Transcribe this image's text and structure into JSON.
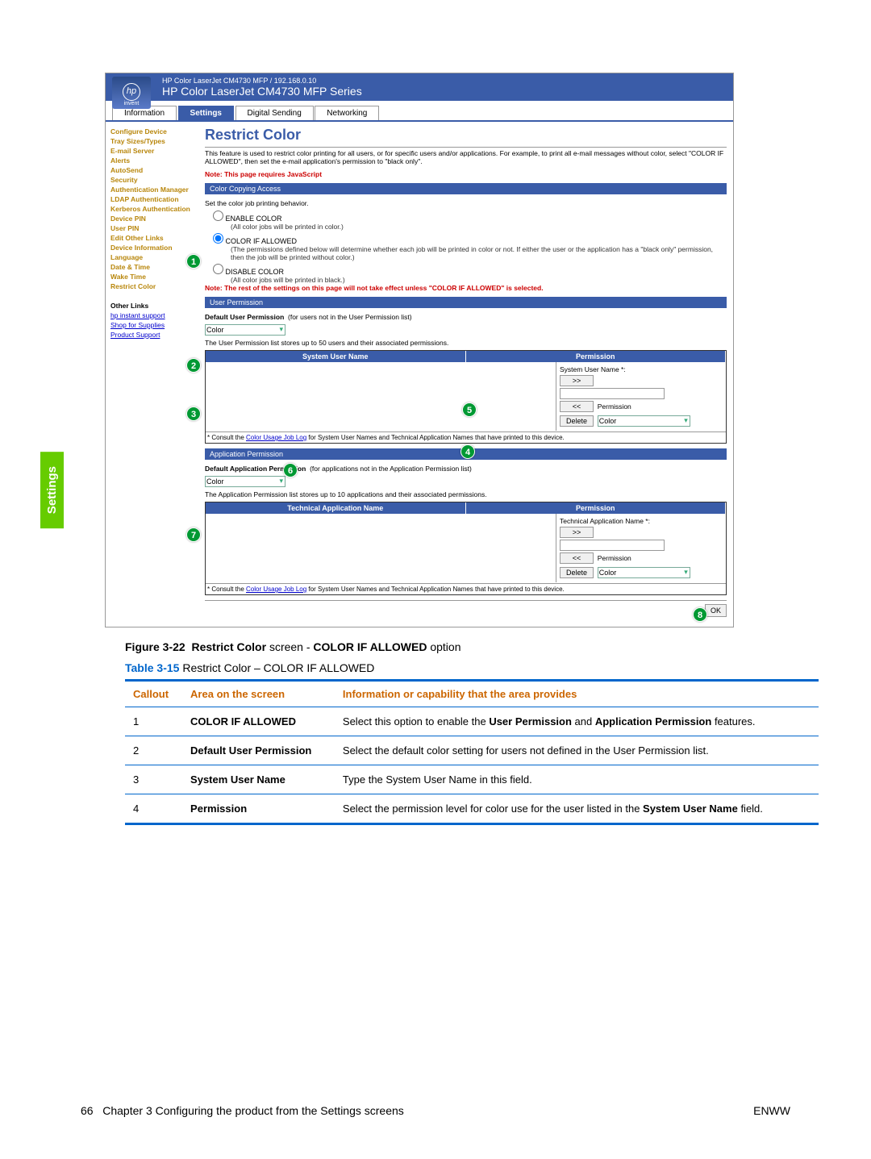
{
  "sideTab": "Settings",
  "header": {
    "line1": "HP Color LaserJet CM4730 MFP / 192.168.0.10",
    "line2": "HP Color LaserJet CM4730 MFP Series",
    "logoBrand": "hp",
    "logoTag": "invent"
  },
  "tabs": [
    "Information",
    "Settings",
    "Digital Sending",
    "Networking"
  ],
  "activeTab": "Settings",
  "nav": {
    "items": [
      "Configure Device",
      "Tray Sizes/Types",
      "E-mail Server",
      "Alerts",
      "AutoSend",
      "Security",
      "Authentication Manager",
      "LDAP Authentication",
      "Kerberos Authentication",
      "Device PIN",
      "User PIN",
      "Edit Other Links",
      "Device Information",
      "Language",
      "Date & Time",
      "Wake Time",
      "Restrict Color"
    ],
    "otherHeader": "Other Links",
    "otherLinks": [
      "hp instant support",
      "Shop for Supplies",
      "Product Support"
    ]
  },
  "main": {
    "title": "Restrict Color",
    "desc": "This feature is used to restrict color printing for all users, or for specific users and/or applications. For example, to print all e-mail messages without color, select \"COLOR IF ALLOWED\", then set the e-mail application's permission to \"black only\".",
    "jsNote": "Note: This page requires JavaScript",
    "bar1": "Color Copying Access",
    "behavior": "Set the color job printing behavior.",
    "opt1": "ENABLE COLOR",
    "opt1sub": "(All color jobs will be printed in color.)",
    "opt2": "COLOR IF ALLOWED",
    "opt2sub": "(The permissions defined below will determine whether each job will be printed in color or not. If either the user or the application has a \"black only\" permission, then the job will be printed without color.)",
    "opt3": "DISABLE COLOR",
    "opt3sub": "(All color jobs will be printed in black.)",
    "note2": "Note: The rest of the settings on this page will not take effect unless \"COLOR IF ALLOWED\" is selected.",
    "bar2": "User Permission",
    "defUserLabel": "Default User Permission",
    "defUserHint": "(for users not in the User Permission list)",
    "defUserVal": "Color",
    "userListDesc": "The User Permission list stores up to 50 users and their associated permissions.",
    "th1a": "System User Name",
    "th1b": "Permission",
    "sysUserLabel": "System User Name *:",
    "permLabel": "Permission",
    "permVal": "Color",
    "btnAdd": ">>",
    "btnRem": "<<",
    "btnDel": "Delete",
    "consult1": "* Consult the ",
    "consultLink": "Color Usage Job Log",
    "consult2": " for System User Names and Technical Application Names that have printed to this device.",
    "bar3": "Application Permission",
    "defAppLabel": "Default Application Permission",
    "defAppHint": "(for applications not in the Application Permission list)",
    "defAppVal": "Color",
    "appListDesc": "The Application Permission list stores up to 10 applications and their associated permissions.",
    "th2a": "Technical Application Name",
    "th2b": "Permission",
    "appNameLabel": "Technical Application Name *:",
    "ok": "OK"
  },
  "callouts": [
    "1",
    "2",
    "3",
    "4",
    "5",
    "6",
    "7",
    "8"
  ],
  "figure": {
    "label": "Figure 3-22",
    "bold1": "Restrict Color",
    "mid": " screen - ",
    "bold2": "COLOR IF ALLOWED",
    "tail": " option"
  },
  "table": {
    "label": "Table 3-15",
    "title": "Restrict Color – COLOR IF ALLOWED",
    "headers": [
      "Callout",
      "Area on the screen",
      "Information or capability that the area provides"
    ],
    "rows": [
      {
        "c": "1",
        "a": "COLOR IF ALLOWED",
        "i_pre": "Select this option to enable the ",
        "i_b1": "User Permission",
        "i_mid": " and ",
        "i_b2": "Application Permission",
        "i_post": " features."
      },
      {
        "c": "2",
        "a": "Default User Permission",
        "i": "Select the default color setting for users not defined in the User Permission list."
      },
      {
        "c": "3",
        "a": "System User Name",
        "i": "Type the System User Name in this field."
      },
      {
        "c": "4",
        "a": "Permission",
        "i_pre": "Select the permission level for color use for the user listed in the ",
        "i_b1": "System User Name",
        "i_post": " field."
      }
    ]
  },
  "footer": {
    "page": "66",
    "chapter": "Chapter 3   Configuring the product from the Settings screens",
    "right": "ENWW"
  }
}
